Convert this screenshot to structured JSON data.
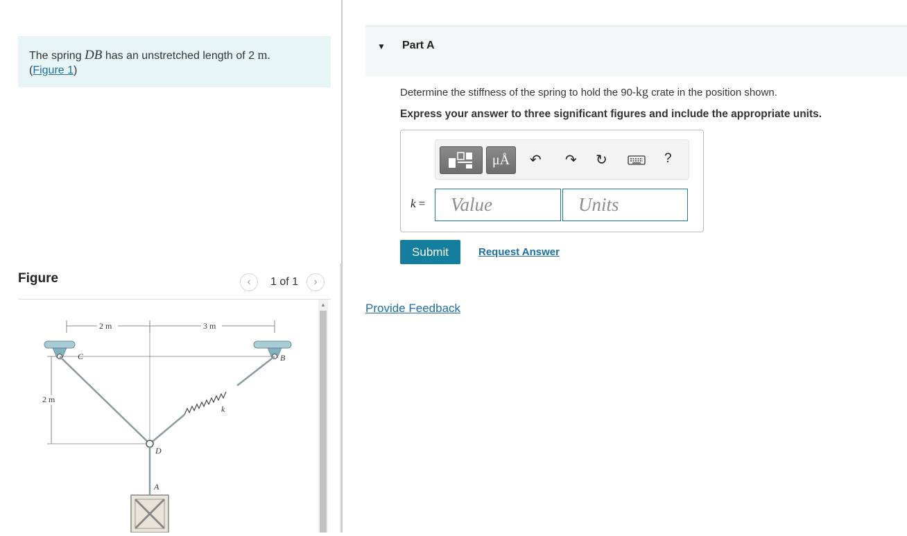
{
  "problem": {
    "text_before": "The spring ",
    "var": "DB",
    "text_middle": " has an unstretched length of 2 ",
    "unit": "m",
    "text_end": ".",
    "figure_link": "Figure 1",
    "link_open": "(",
    "link_close": ")"
  },
  "figure": {
    "title": "Figure",
    "pager": "1 of 1",
    "labels": {
      "dim_left": "2 m",
      "dim_right": "3 m",
      "dim_vertical": "2 m",
      "point_c": "C",
      "point_b": "B",
      "point_d": "D",
      "point_a": "A",
      "spring_k": "k"
    }
  },
  "part": {
    "title": "Part A",
    "question_before": "Determine the stiffness of the spring to hold the 90-",
    "question_unit": "kg",
    "question_after": " crate in the position shown.",
    "instruction": "Express your answer to three significant figures and include the appropriate units.",
    "answer_label_var": "k",
    "answer_label_eq": " =",
    "value_placeholder": "Value",
    "units_placeholder": "Units",
    "toolbar": {
      "units_button": "μÅ",
      "help": "?"
    },
    "submit": "Submit",
    "request_answer": "Request Answer"
  },
  "feedback": "Provide Feedback"
}
